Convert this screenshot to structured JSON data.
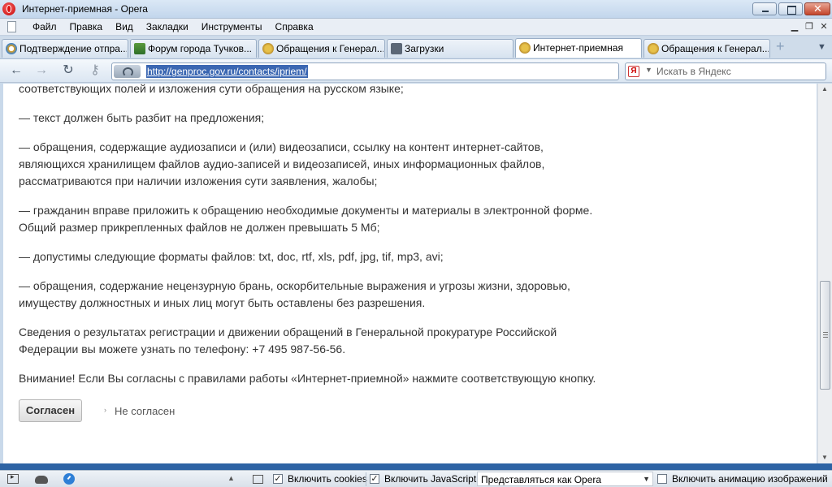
{
  "window": {
    "title": "Интернет-приемная - Opera"
  },
  "menu": {
    "items": [
      "Файл",
      "Правка",
      "Вид",
      "Закладки",
      "Инструменты",
      "Справка"
    ]
  },
  "tabs": [
    {
      "label": "Подтверждение отпра...",
      "icon": "opera-icon",
      "active": false
    },
    {
      "label": "Форум города Тучков...",
      "icon": "forum-icon",
      "active": false
    },
    {
      "label": "Обращения к Генерал...",
      "icon": "emblem-icon",
      "active": false
    },
    {
      "label": "Загрузки",
      "icon": "downloads-icon",
      "active": false
    },
    {
      "label": "Интернет-приемная",
      "icon": "emblem-icon",
      "active": true
    },
    {
      "label": "Обращения к Генерал...",
      "icon": "emblem-icon",
      "active": false
    }
  ],
  "address": {
    "url": "http://genproc.gov.ru/contacts/ipriem/"
  },
  "search": {
    "engine": "Я",
    "placeholder": "Искать в Яндекс"
  },
  "content": {
    "lines": [
      "соответствующих полей и изложения сути обращения на русском языке;",
      "— текст должен быть разбит на предложения;",
      "— обращения, содержащие аудиозаписи и (или) видеозаписи, ссылку на контент интернет-сайтов,",
      "являющихся хранилищем файлов аудио-записей и видеозаписей, иных информационных файлов,",
      "рассматриваются при наличии изложения сути заявления, жалобы;",
      "— гражданин вправе приложить к обращению необходимые документы и материалы в электронной форме.",
      "Общий размер прикрепленных файлов не должен превышать 5 Мб;",
      "— допустимы следующие форматы файлов: txt, doc, rtf, xls, pdf, jpg, tif, mp3, avi;",
      "— обращения, содержание нецензурную брань, оскорбительные выражения и угрозы жизни, здоровью,",
      "имуществу должностных и иных лиц могут быть оставлены без разрешения.",
      "Сведения о результатах регистрации и движении обращений в Генеральной прокуратуре Российской",
      "Федерации вы можете узнать по телефону: +7 495 987-56-56.",
      "Внимание! Если Вы согласны с правилами работы «Интернет-приемной» нажмите соответствующую кнопку."
    ],
    "agree_button": "Согласен",
    "disagree_link": "Не согласен"
  },
  "statusbar": {
    "cookies_label": "Включить cookies",
    "cookies_checked": true,
    "javascript_label": "Включить JavaScript",
    "javascript_checked": true,
    "identify_as": "Представляться как Opera",
    "animation_label": "Включить анимацию изображений",
    "animation_checked": false
  },
  "colors": {
    "url_highlight": "#3b67b2",
    "status_strip": "#2d63a4",
    "text": "#333333"
  }
}
